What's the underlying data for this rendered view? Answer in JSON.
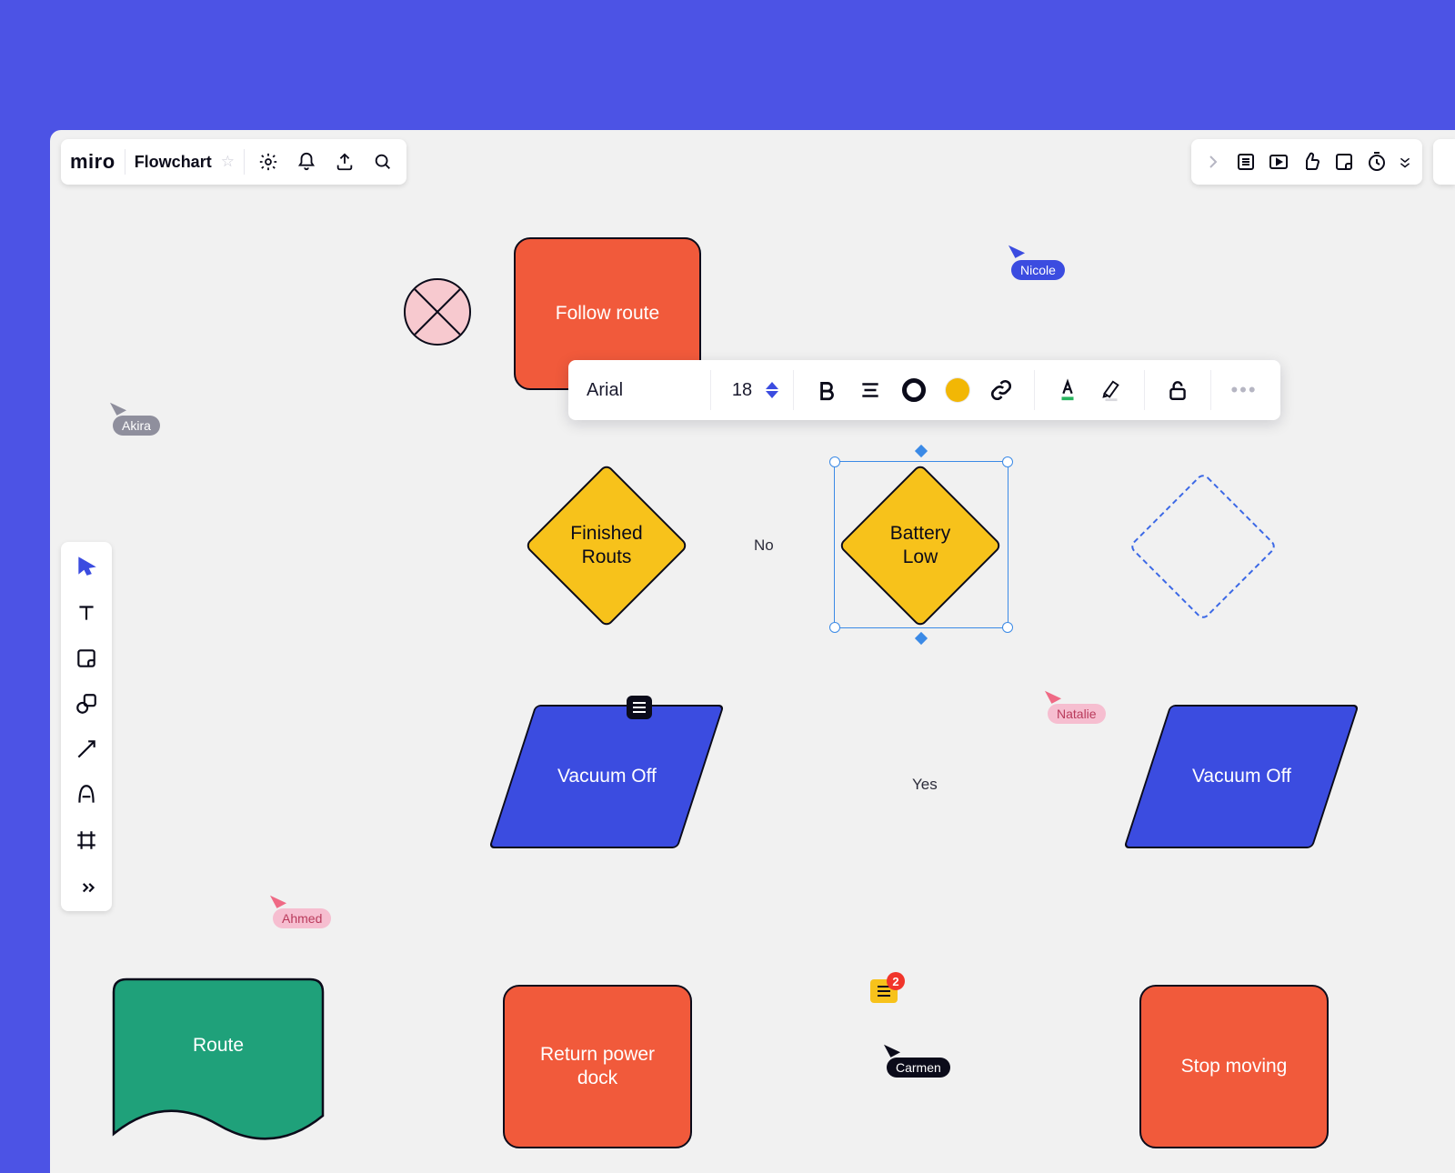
{
  "board": {
    "logo": "miro",
    "title": "Flowchart"
  },
  "context_toolbar": {
    "font": "Arial",
    "size": "18"
  },
  "presence": {
    "akira": "Akira",
    "nicole": "Nicole",
    "ahmed": "Ahmed",
    "natalie": "Natalie",
    "carmen": "Carmen"
  },
  "notes_badge": "2",
  "shapes": {
    "follow_route": "Follow route",
    "finished_routs": "Finished\nRouts",
    "battery_low": "Battery\nLow",
    "vacuum_off": "Vacuum Off",
    "vacuum_off_2": "Vacuum Off",
    "return_dock": "Return power\ndock",
    "stop_moving": "Stop moving",
    "route": "Route"
  },
  "edges": {
    "no": "No",
    "yes": "Yes"
  }
}
